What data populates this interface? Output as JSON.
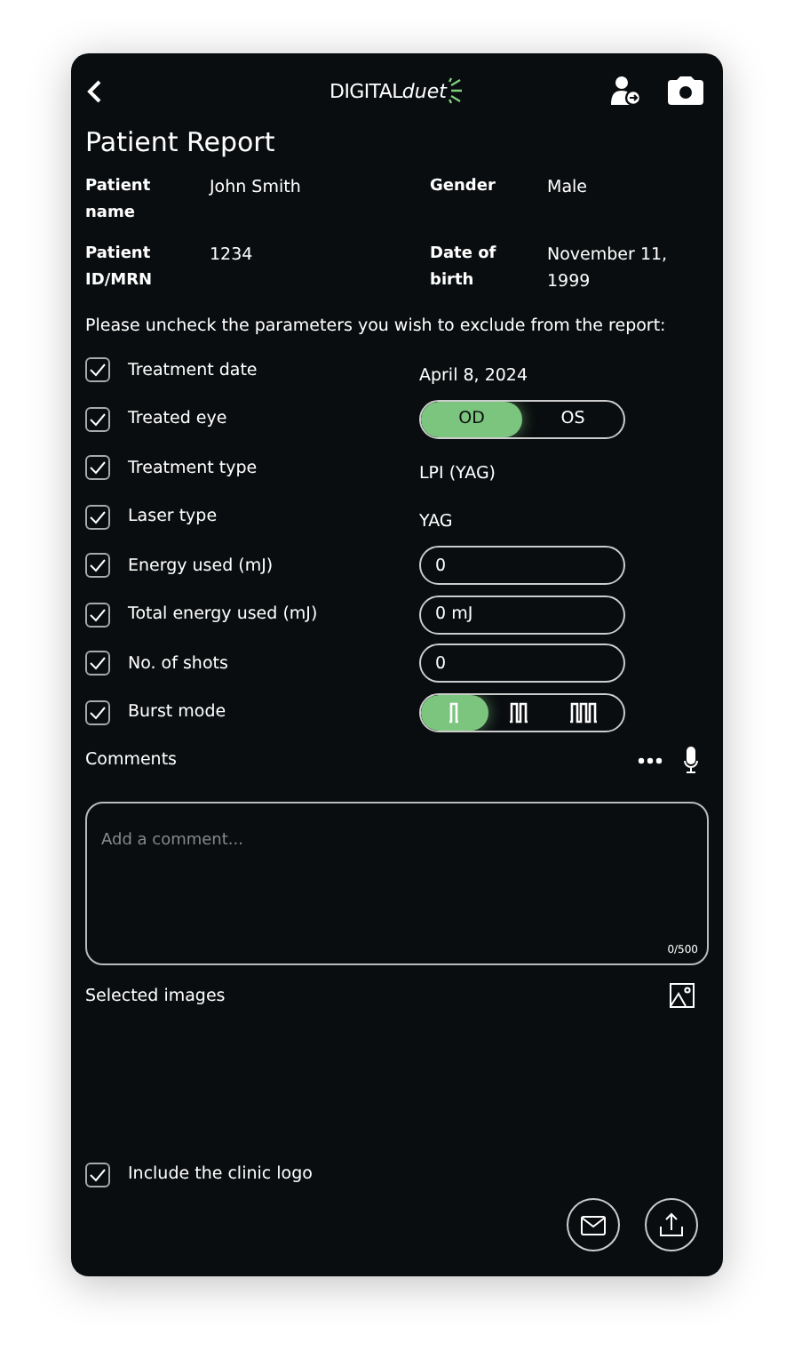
{
  "header": {
    "logo_part_1": "DIGITAL",
    "logo_part_2": "duet"
  },
  "title": "Patient Report",
  "patient": [
    {
      "label": "Patient name",
      "value": "John Smith"
    },
    {
      "label": "Gender",
      "value": "Male"
    },
    {
      "label": "Patient ID/MRN",
      "value": "1234"
    },
    {
      "label": "Date of birth",
      "value": "November 11, 1999"
    }
  ],
  "instruction": "Please uncheck the parameters you wish to exclude from the report:",
  "parameters": [
    {
      "kind": "text",
      "label": "Treatment date",
      "checked": true,
      "value": "April 8, 2024"
    },
    {
      "kind": "toggle",
      "label": "Treated eye",
      "checked": true,
      "options": [
        {
          "label": "OD",
          "selected": true
        },
        {
          "label": "OS",
          "selected": false
        }
      ]
    },
    {
      "kind": "text",
      "label": "Treatment type",
      "checked": true,
      "value": "LPI (YAG)"
    },
    {
      "kind": "text",
      "label": "Laser type",
      "checked": true,
      "value": "YAG"
    },
    {
      "kind": "input",
      "label": "Energy used (mJ)",
      "checked": true,
      "value": "0"
    },
    {
      "kind": "input",
      "label": "Total energy used (mJ)",
      "checked": true,
      "value": "0 mJ"
    },
    {
      "kind": "input",
      "label": "No. of shots",
      "checked": true,
      "value": "0"
    },
    {
      "kind": "burst",
      "label": "Burst mode",
      "checked": true,
      "options": [
        {
          "selected": true
        },
        {
          "selected": false
        },
        {
          "selected": false
        }
      ]
    }
  ],
  "comments": {
    "label": "Comments",
    "placeholder": "Add a comment...",
    "counter": "0/500"
  },
  "images": {
    "label": "Selected images"
  },
  "clinic_logo": {
    "label": "Include the clinic logo",
    "checked": true
  }
}
